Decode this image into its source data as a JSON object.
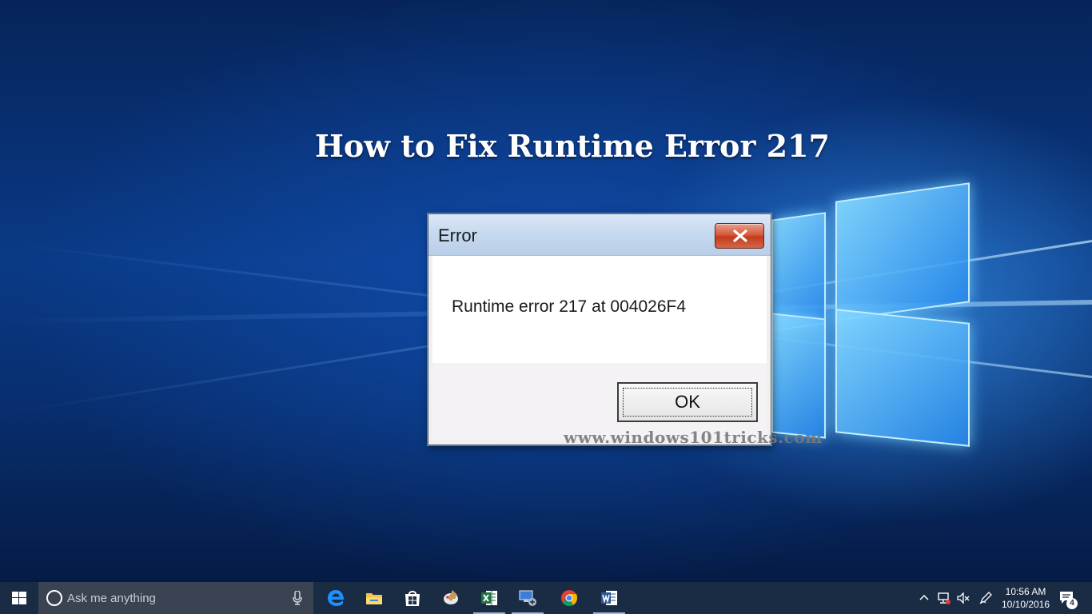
{
  "headline": "How to Fix Runtime Error 217",
  "dialog": {
    "title": "Error",
    "message": "Runtime error 217 at 004026F4",
    "ok_label": "OK"
  },
  "watermark": "www.windows101tricks.com",
  "taskbar": {
    "search_placeholder": "Ask me anything",
    "apps": [
      {
        "name": "edge-icon"
      },
      {
        "name": "file-explorer-icon"
      },
      {
        "name": "store-icon"
      },
      {
        "name": "paint-icon"
      },
      {
        "name": "excel-icon"
      },
      {
        "name": "remote-desktop-icon"
      },
      {
        "name": "chrome-icon"
      },
      {
        "name": "word-icon"
      }
    ],
    "clock": {
      "time": "10:56 AM",
      "date": "10/10/2016"
    },
    "notification_count": "4"
  },
  "colors": {
    "taskbar_bg": "#1a2b44",
    "close_button": "#c33c1c",
    "titlebar": "#c5d8ee"
  }
}
